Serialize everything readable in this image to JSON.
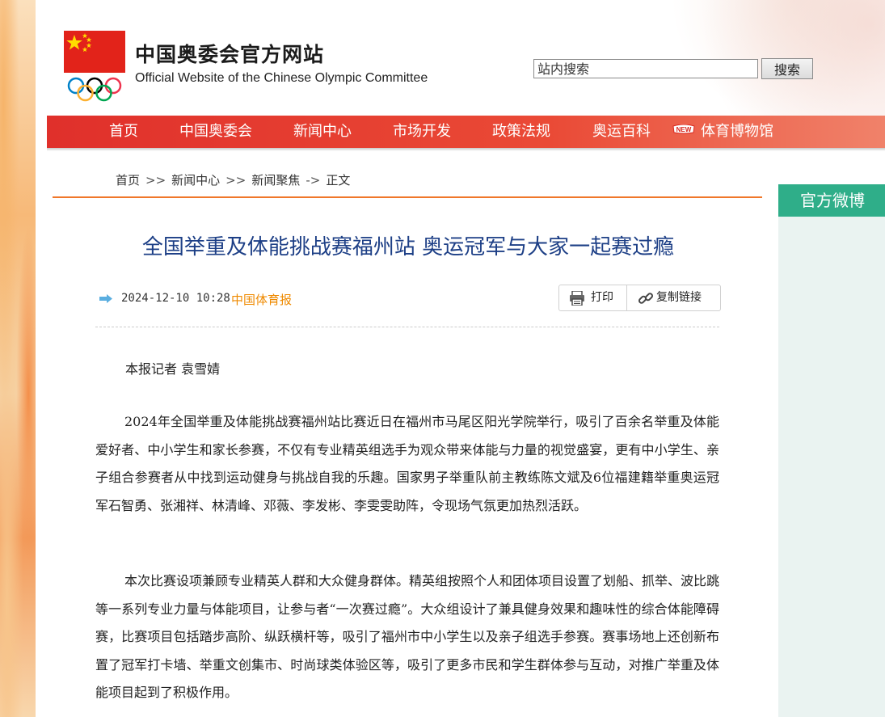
{
  "header": {
    "title_cn": "中国奥委会官方网站",
    "title_en": "Official Website of the Chinese Olympic Committee",
    "flag_icon": "china-flag-icon",
    "rings_icon": "olympic-rings-icon"
  },
  "search": {
    "placeholder": "站内搜索",
    "button_label": "搜索"
  },
  "nav": {
    "items": [
      {
        "label": "首页"
      },
      {
        "label": "中国奥委会"
      },
      {
        "label": "新闻中心"
      },
      {
        "label": "市场开发"
      },
      {
        "label": "政策法规"
      },
      {
        "label": "奥运百科"
      },
      {
        "label": "体育博物馆"
      }
    ],
    "new_badge": "NEW"
  },
  "breadcrumb": {
    "items": [
      "首页",
      "新闻中心",
      "新闻聚焦",
      "正文"
    ],
    "sep1": ">>",
    "sep2": ">>",
    "sep3": "->"
  },
  "sidebar": {
    "weibo_label": "官方微博"
  },
  "article": {
    "title": "全国举重及体能挑战赛福州站 奥运冠军与大家一起赛过瘾",
    "datetime": "2024-12-10 10:28",
    "source": "中国体育报",
    "print_label": "打印",
    "copy_link_label": "复制链接",
    "byline": "本报记者 袁雪婧",
    "paragraphs": [
      "2024年全国举重及体能挑战赛福州站比赛近日在福州市马尾区阳光学院举行，吸引了百余名举重及体能爱好者、中小学生和家长参赛，不仅有专业精英组选手为观众带来体能与力量的视觉盛宴，更有中小学生、亲子组合参赛者从中找到运动健身与挑战自我的乐趣。国家男子举重队前主教练陈文斌及6位福建籍举重奥运冠军石智勇、张湘祥、林清峰、邓薇、李发彬、李雯雯助阵，令现场气氛更加热烈活跃。",
      "本次比赛设项兼顾专业精英人群和大众健身群体。精英组按照个人和团体项目设置了划船、抓举、波比跳等一系列专业力量与体能项目，让参与者“一次赛过瘾”。大众组设计了兼具健身效果和趣味性的综合体能障碍赛，比赛项目包括踏步高阶、纵跃横杆等，吸引了福州市中小学生以及亲子组选手参赛。赛事场地上还创新布置了冠军打卡墙、举重文创集市、时尚球类体验区等，吸引了更多市民和学生群体参与互动，对推广举重及体能项目起到了积极作用。"
    ]
  },
  "colors": {
    "nav_red": "#e0302b",
    "title_blue": "#1d3f86",
    "source_orange": "#ef8a00",
    "weibo_green": "#2fae89",
    "rule_orange": "#f0772a"
  }
}
